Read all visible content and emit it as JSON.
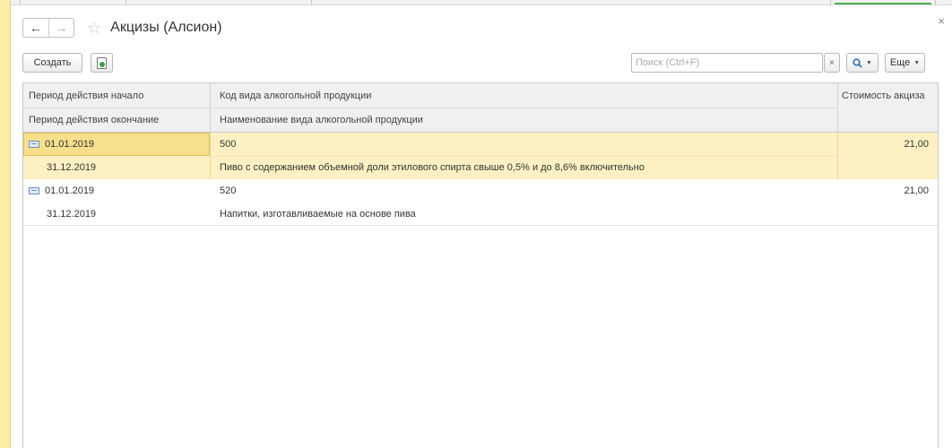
{
  "window": {
    "title": "Акцизы (Алсион)"
  },
  "toolbar": {
    "create_label": "Создать",
    "search_placeholder": "Поиск (Ctrl+F)",
    "clear_label": "×",
    "more_label": "Еще"
  },
  "table": {
    "headers": {
      "period_start": "Период действия начало",
      "period_end": "Период действия окончание",
      "product_code": "Код вида алкогольной продукции",
      "product_name": "Наименование вида алкогольной продукции",
      "excise_cost": "Стоимость акциза"
    },
    "rows": [
      {
        "start": "01.01.2019",
        "end": "31.12.2019",
        "code": "500",
        "name": "Пиво с содержанием объемной доли этилового спирта свыше 0,5% и до 8,6% включительно",
        "cost": "21,00",
        "selected": true
      },
      {
        "start": "01.01.2019",
        "end": "31.12.2019",
        "code": "520",
        "name": "Напитки, изготавливаемые на основе пива",
        "cost": "21,00",
        "selected": false
      }
    ]
  },
  "colors": {
    "left_panel": "#fbeea8",
    "selected_row": "#fdf1c3",
    "active_cell": "#f8df8c"
  },
  "icons": [
    "close-icon",
    "back-arrow-icon",
    "forward-arrow-icon",
    "star-icon",
    "copy-icon",
    "search-icon",
    "record-icon"
  ]
}
